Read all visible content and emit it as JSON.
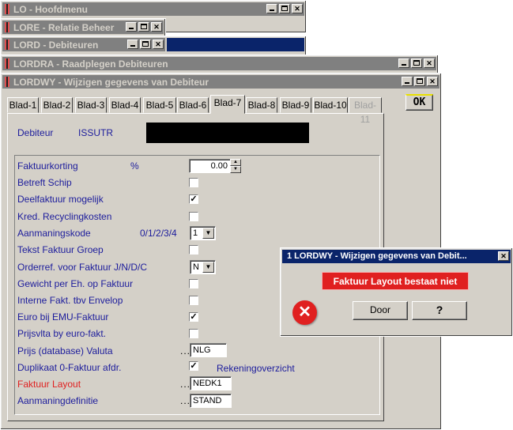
{
  "windows": {
    "w1": {
      "title": "LO - Hoofdmenu"
    },
    "w2": {
      "title": "LORE - Relatie Beheer"
    },
    "w3": {
      "title": "LORD - Debiteuren"
    },
    "w4": {
      "title": "LORDRA - Raadplegen Debiteuren"
    },
    "w5": {
      "title": "LORDWY - Wijzigen gegevens van Debiteur"
    }
  },
  "tabs": [
    "Blad-1",
    "Blad-2",
    "Blad-3",
    "Blad-4",
    "Blad-5",
    "Blad-6",
    "Blad-7",
    "Blad-8",
    "Blad-9",
    "Blad-10",
    "Blad-11"
  ],
  "selected_tab": "Blad-7",
  "ok_label": "OK",
  "debiteur": {
    "label": "Debiteur",
    "code": "ISSUTR"
  },
  "fields": {
    "faktuurkorting": {
      "label": "Faktuurkorting",
      "unit": "%",
      "value": "0.00"
    },
    "betreft_schip": {
      "label": "Betreft Schip",
      "checked": false
    },
    "deelfaktuur": {
      "label": "Deelfaktuur mogelijk",
      "checked": true
    },
    "kred_recycling": {
      "label": "Kred. Recyclingkosten",
      "checked": false
    },
    "aanmaningskode": {
      "label": "Aanmaningskode",
      "hint": "0/1/2/3/4",
      "value": "1"
    },
    "tekst_faktuur": {
      "label": "Tekst Faktuur Groep",
      "checked": false
    },
    "orderref": {
      "label": "Orderref. voor Faktuur J/N/D/C",
      "value": "N"
    },
    "gewicht": {
      "label": "Gewicht per Eh. op Faktuur",
      "checked": false
    },
    "interne_fakt": {
      "label": "Interne Fakt. tbv Envelop",
      "checked": false
    },
    "euro_emu": {
      "label": "Euro bij EMU-Faktuur",
      "checked": true
    },
    "prijsvlta": {
      "label": "Prijsvlta by euro-fakt.",
      "checked": false
    },
    "prijs_valuta": {
      "label": "Prijs (database) Valuta",
      "dots": "...",
      "value": "NLG"
    },
    "duplikaat": {
      "label": "Duplikaat 0-Faktuur afdr.",
      "checked": true,
      "extra": "Rekeningoverzicht"
    },
    "faktuur_layout": {
      "label": "Faktuur Layout",
      "dots": "...",
      "value": "NEDK1"
    },
    "aanmaningdef": {
      "label": "Aanmaningdefinitie",
      "dots": "...",
      "value": "STAND"
    }
  },
  "dialog": {
    "title": "1 LORDWY - Wijzigen gegevens van Debit...",
    "message": "Faktuur Layout bestaat niet",
    "door_label": "Door",
    "help_label": "?"
  },
  "colors": {
    "label_blue": "#1c1c9c",
    "error_red": "#e02020",
    "title_active": "#0a246a",
    "title_inactive": "#808080"
  }
}
